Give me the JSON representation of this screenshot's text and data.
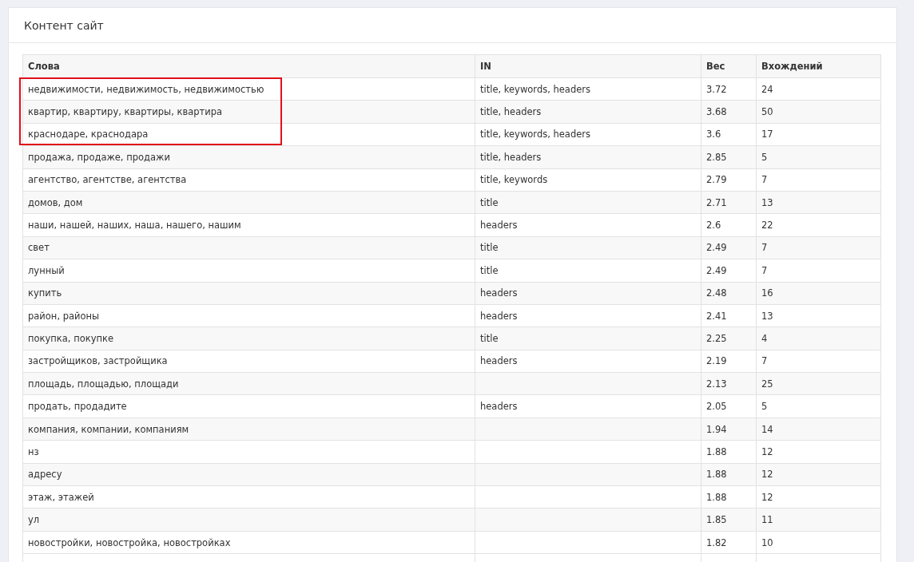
{
  "panel": {
    "title": "Контент сайт"
  },
  "table": {
    "columns": [
      "Слова",
      "IN",
      "Вес",
      "Вхождений"
    ],
    "rows": [
      {
        "words": "недвижимости, недвижимость, недвижимостью",
        "in": "title, keywords, headers",
        "weight": "3.72",
        "count": "24",
        "highlighted": true
      },
      {
        "words": "квартир, квартиру, квартиры, квартира",
        "in": "title, headers",
        "weight": "3.68",
        "count": "50",
        "highlighted": true
      },
      {
        "words": "краснодаре, краснодара",
        "in": "title, keywords, headers",
        "weight": "3.6",
        "count": "17",
        "highlighted": true
      },
      {
        "words": "продажа, продаже, продажи",
        "in": "title, headers",
        "weight": "2.85",
        "count": "5",
        "highlighted": false
      },
      {
        "words": "агентство, агентстве, агентства",
        "in": "title, keywords",
        "weight": "2.79",
        "count": "7",
        "highlighted": false
      },
      {
        "words": "домов, дом",
        "in": "title",
        "weight": "2.71",
        "count": "13",
        "highlighted": false
      },
      {
        "words": "наши, нашей, наших, наша, нашего, нашим",
        "in": "headers",
        "weight": "2.6",
        "count": "22",
        "highlighted": false
      },
      {
        "words": "свет",
        "in": "title",
        "weight": "2.49",
        "count": "7",
        "highlighted": false
      },
      {
        "words": "лунный",
        "in": "title",
        "weight": "2.49",
        "count": "7",
        "highlighted": false
      },
      {
        "words": "купить",
        "in": "headers",
        "weight": "2.48",
        "count": "16",
        "highlighted": false
      },
      {
        "words": "район, районы",
        "in": "headers",
        "weight": "2.41",
        "count": "13",
        "highlighted": false
      },
      {
        "words": "покупка, покупке",
        "in": "title",
        "weight": "2.25",
        "count": "4",
        "highlighted": false
      },
      {
        "words": "застройщиков, застройщика",
        "in": "headers",
        "weight": "2.19",
        "count": "7",
        "highlighted": false
      },
      {
        "words": "площадь, площадью, площади",
        "weight": "2.13",
        "count": "25",
        "highlighted": false
      },
      {
        "words": "продать, продадите",
        "in": "headers",
        "weight": "2.05",
        "count": "5",
        "highlighted": false
      },
      {
        "words": "компания, компании, компаниям",
        "weight": "1.94",
        "count": "14",
        "highlighted": false
      },
      {
        "words": "нз",
        "weight": "1.88",
        "count": "12",
        "highlighted": false
      },
      {
        "words": "адресу",
        "weight": "1.88",
        "count": "12",
        "highlighted": false
      },
      {
        "words": "этаж, этажей",
        "weight": "1.88",
        "count": "12",
        "highlighted": false
      },
      {
        "words": "ул",
        "weight": "1.85",
        "count": "11",
        "highlighted": false
      },
      {
        "words": "новостройки, новостройка, новостройках",
        "weight": "1.82",
        "count": "10",
        "highlighted": false
      }
    ]
  }
}
